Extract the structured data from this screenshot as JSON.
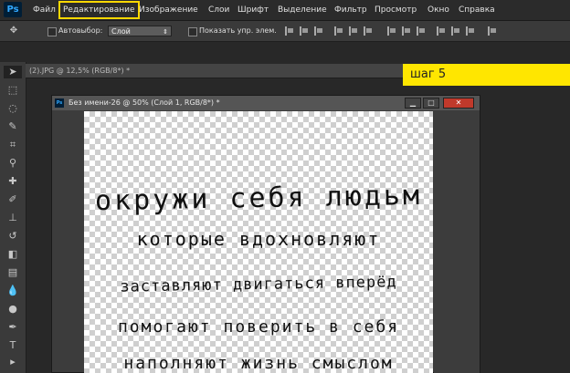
{
  "menubar": {
    "logo": "Ps",
    "items": [
      "Файл",
      "Редактирование",
      "Изображение",
      "Слои",
      "Шрифт",
      "Выделение",
      "Фильтр",
      "Просмотр",
      "Окно",
      "Справка"
    ]
  },
  "options": {
    "autoselect_label": "Автовыбор:",
    "autoselect_value": "Слой",
    "show_controls_label": "Показать упр. элем."
  },
  "background_doc": {
    "title": "(2).JPG @ 12,5% (RGB/8*) *"
  },
  "step_label": "шаг 5",
  "document": {
    "title": "Без имени-26 @ 50% (Слой 1, RGB/8*) *",
    "lines": [
      "окружи себя людьм",
      "которые вдохновляют",
      "заставляют двигаться вперёд",
      "помогают поверить в себя",
      "наполняют жизнь смыслом"
    ]
  },
  "tools": [
    "move-tool-icon",
    "marquee-tool-icon",
    "lasso-tool-icon",
    "quick-select-tool-icon",
    "crop-tool-icon",
    "eyedropper-tool-icon",
    "healing-brush-icon",
    "brush-tool-icon",
    "clone-stamp-icon",
    "history-brush-icon",
    "eraser-tool-icon",
    "gradient-tool-icon",
    "blur-tool-icon",
    "dodge-tool-icon",
    "pen-tool-icon",
    "type-tool-icon"
  ],
  "colors": {
    "highlight": "#ffd800",
    "step_bg": "#ffe600"
  }
}
